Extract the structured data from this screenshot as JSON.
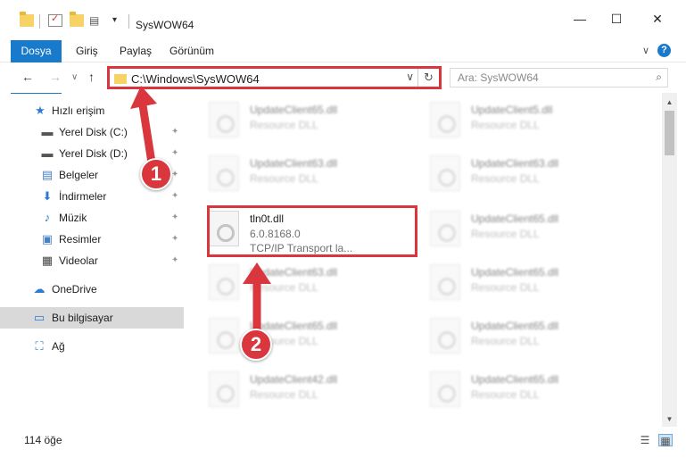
{
  "window": {
    "title": "SysWOW64",
    "minimize_glyph": "—",
    "maximize_glyph": "☐",
    "close_glyph": "✕"
  },
  "ribbon": {
    "tabs": [
      "Dosya",
      "Giriş",
      "Paylaş",
      "Görünüm"
    ],
    "expand_glyph": "∨",
    "help_glyph": "?"
  },
  "nav": {
    "back_glyph": "←",
    "forward_glyph": "→",
    "recent_glyph": "∨",
    "up_glyph": "↑",
    "address": "C:\\Windows\\SysWOW64",
    "dropdown_glyph": "∨",
    "refresh_glyph": "↻",
    "search_placeholder": "Ara: SysWOW64",
    "search_glyph": "⌕"
  },
  "sidebar": {
    "items": [
      {
        "label": "Hızlı erişim",
        "icon": "star-icon",
        "glyph": "★",
        "color": "#2b7cd3",
        "pinned": false
      },
      {
        "label": "Yerel Disk (C:)",
        "icon": "drive-icon",
        "glyph": "▬",
        "color": "#555555",
        "pinned": true
      },
      {
        "label": "Yerel Disk (D:)",
        "icon": "drive-icon",
        "glyph": "▬",
        "color": "#555555",
        "pinned": true
      },
      {
        "label": "Belgeler",
        "icon": "documents-icon",
        "glyph": "▤",
        "color": "#4a7fc1",
        "pinned": true
      },
      {
        "label": "İndirmeler",
        "icon": "downloads-icon",
        "glyph": "⬇",
        "color": "#2b7cd3",
        "pinned": true
      },
      {
        "label": "Müzik",
        "icon": "music-icon",
        "glyph": "♪",
        "color": "#2b7cd3",
        "pinned": true
      },
      {
        "label": "Resimler",
        "icon": "pictures-icon",
        "glyph": "▣",
        "color": "#4a7fc1",
        "pinned": true
      },
      {
        "label": "Videolar",
        "icon": "videos-icon",
        "glyph": "▦",
        "color": "#444444",
        "pinned": true
      },
      {
        "label": "OneDrive",
        "icon": "cloud-icon",
        "glyph": "☁",
        "color": "#2b7cd3",
        "pinned": false
      },
      {
        "label": "Bu bilgisayar",
        "icon": "computer-icon",
        "glyph": "▭",
        "color": "#2b7cd3",
        "pinned": false
      },
      {
        "label": "Ağ",
        "icon": "network-icon",
        "glyph": "⛶",
        "color": "#2b7cd3",
        "pinned": false
      }
    ],
    "pin_glyph": "📌"
  },
  "files": [
    {
      "name": "UpdateClient65.dll",
      "desc": "Resource DLL",
      "version": ""
    },
    {
      "name": "UpdateClient5.dll",
      "desc": "Resource DLL",
      "version": ""
    },
    {
      "name": "UpdateClient63.dll",
      "desc": "Resource DLL",
      "version": ""
    },
    {
      "name": "UpdateClient63.dll",
      "desc": "Resource DLL",
      "version": ""
    },
    {
      "name": "tln0t.dll",
      "version": "6.0.8168.0",
      "desc": "TCP/IP Transport la..."
    },
    {
      "name": "UpdateClient65.dll",
      "desc": "Resource DLL",
      "version": ""
    },
    {
      "name": "UpdateClient63.dll",
      "desc": "Resource DLL",
      "version": ""
    },
    {
      "name": "UpdateClient65.dll",
      "desc": "Resource DLL",
      "version": ""
    },
    {
      "name": "UpdateClient65.dll",
      "desc": "Resource DLL",
      "version": ""
    },
    {
      "name": "UpdateClient65.dll",
      "desc": "Resource DLL",
      "version": ""
    },
    {
      "name": "UpdateClient42.dll",
      "desc": "Resource DLL",
      "version": ""
    },
    {
      "name": "UpdateClient65.dll",
      "desc": "Resource DLL",
      "version": ""
    }
  ],
  "status": {
    "count": "114 öğe",
    "details_view_glyph": "☰",
    "icons_view_glyph": "▦"
  },
  "annotations": {
    "step1": "1",
    "step2": "2",
    "color": "#d9363e"
  }
}
